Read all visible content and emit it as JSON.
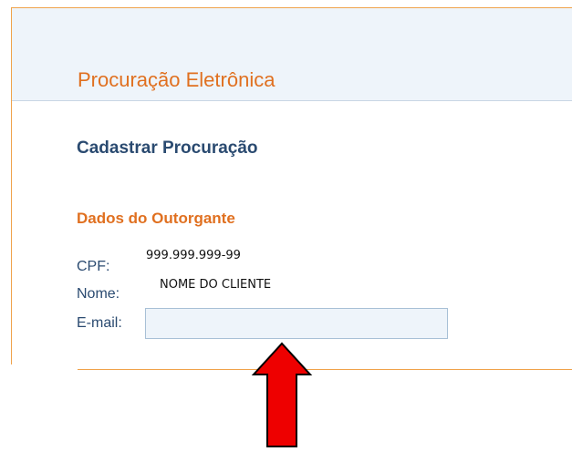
{
  "page": {
    "title": "Procuração Eletrônica"
  },
  "form": {
    "title": "Cadastrar Procuração",
    "section_title": "Dados do Outorgante",
    "cpf": {
      "label": "CPF:",
      "value": "999.999.999-99"
    },
    "name": {
      "label": "Nome:",
      "value": "NOME DO CLIENTE"
    },
    "email": {
      "label": "E-mail:",
      "value": "",
      "placeholder": ""
    }
  },
  "annotation": {
    "arrow_color": "#ee0000",
    "arrow_target": "email-input"
  },
  "colors": {
    "accent": "#e07020",
    "heading": "#2a4a70",
    "header_bg": "#eef4fa",
    "border": "#f0a24a"
  }
}
